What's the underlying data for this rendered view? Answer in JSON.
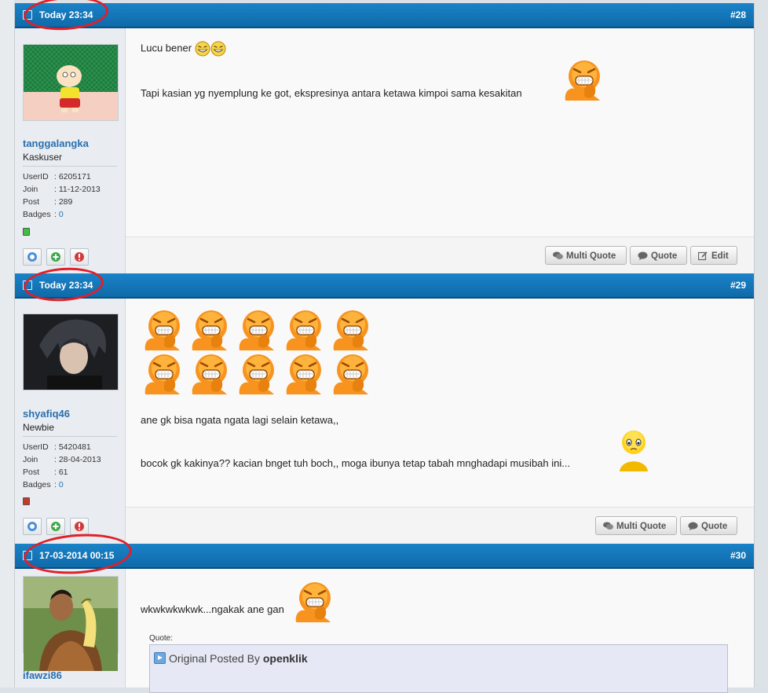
{
  "posts": [
    {
      "date": "Today 23:34",
      "number": "#28",
      "user": {
        "name": "tanggalangka",
        "rank": "Kaskuser",
        "userid_label": "UserID",
        "userid": ": 6205171",
        "join_label": "Join",
        "join": ": 11-12-2013",
        "post_label": "Post",
        "post": ": 289",
        "badges_label": "Badges",
        "badges_sep": ": ",
        "badges": "0",
        "status_color": "#3fbf3f"
      },
      "lines": [
        "Lucu bener",
        "Tapi kasian yg nyemplung ke got, ekspresinya antara ketawa kimpoi sama kesakitan"
      ],
      "buttons": [
        "Multi Quote",
        "Quote",
        "Edit"
      ]
    },
    {
      "date": "Today 23:34",
      "number": "#29",
      "user": {
        "name": "shyafiq46",
        "rank": "Newbie",
        "userid_label": "UserID",
        "userid": ": 5420481",
        "join_label": "Join",
        "join": ": 28-04-2013",
        "post_label": "Post",
        "post": ": 61",
        "badges_label": "Badges",
        "badges_sep": ": ",
        "badges": "0",
        "status_color": "#c23a2e"
      },
      "lines": [
        "ane gk bisa ngata ngata lagi selain ketawa,,",
        "bocok gk kakinya?? kacian bnget tuh boch,, moga ibunya tetap tabah mnghadapi musibah ini..."
      ],
      "buttons": [
        "Multi Quote",
        "Quote"
      ]
    },
    {
      "date": "17-03-2014 00:15",
      "number": "#30",
      "user": {
        "name": "ifawzi86"
      },
      "lines": [
        "wkwkwkwkwk...ngakak ane gan"
      ],
      "quote": {
        "label": "Quote:",
        "prefix": "Original Posted By ",
        "author": "openklik"
      }
    }
  ],
  "colors": {
    "header_blue": "#1a82c8",
    "username_blue": "#2a6fb0",
    "annotation_red": "#e21f28"
  },
  "icons": [
    "profile-icon",
    "add-friend-icon",
    "report-icon",
    "multi-quote-icon",
    "quote-icon",
    "edit-icon",
    "laugh-emoticon",
    "grin-emoticon",
    "sad-emoticon"
  ]
}
